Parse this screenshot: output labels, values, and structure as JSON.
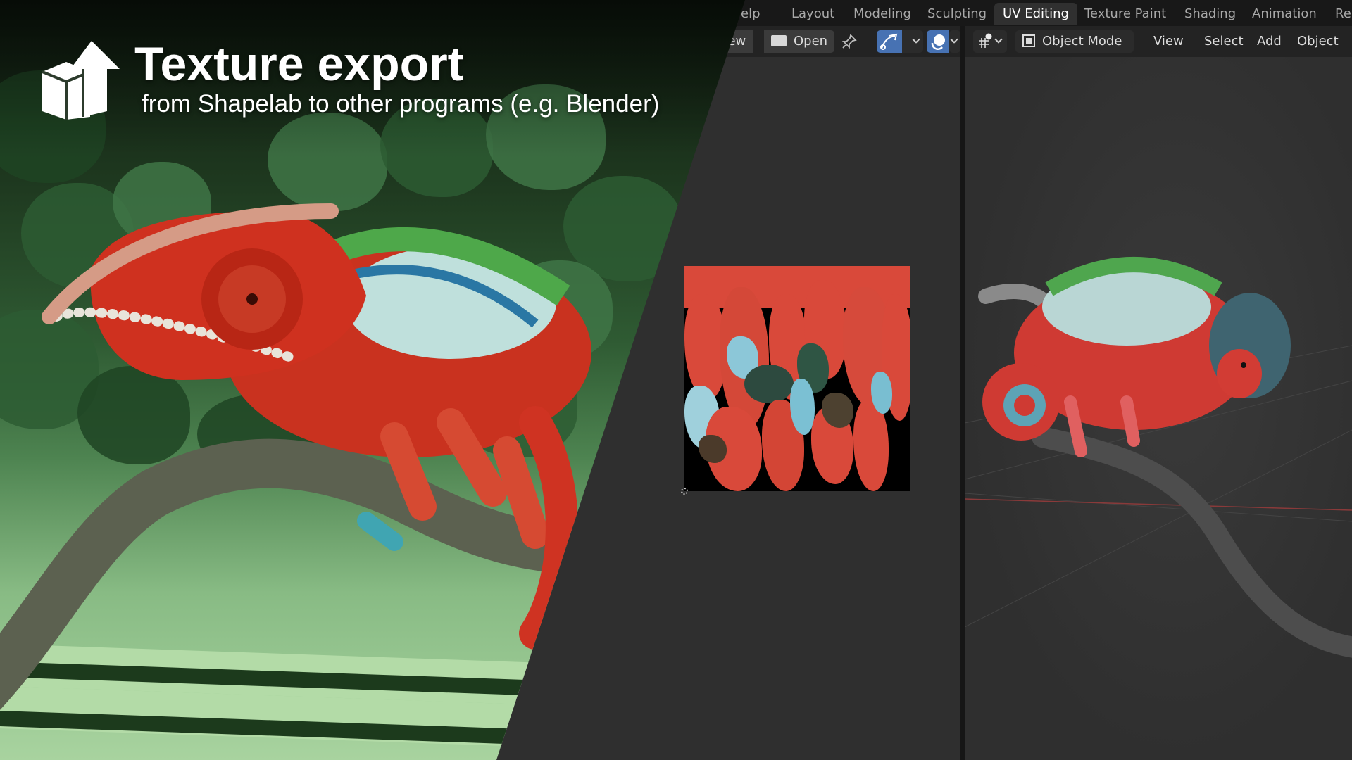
{
  "overlay": {
    "title": "Texture export",
    "subtitle": "from Shapelab to other programs (e.g. Blender)",
    "logo_icon": "box-upload-icon"
  },
  "blender": {
    "workspace_tabs": [
      {
        "label": "elp",
        "active": false
      },
      {
        "label": "Layout",
        "active": false
      },
      {
        "label": "Modeling",
        "active": false
      },
      {
        "label": "Sculpting",
        "active": false
      },
      {
        "label": "UV Editing",
        "active": true
      },
      {
        "label": "Texture Paint",
        "active": false
      },
      {
        "label": "Shading",
        "active": false
      },
      {
        "label": "Animation",
        "active": false
      },
      {
        "label": "Re",
        "active": false
      }
    ],
    "uv_editor_header": {
      "new_label": "New",
      "open_label": "Open",
      "pin_icon": "pin-icon",
      "uv_sync_icon": "uv-sync-icon",
      "overlay_icon": "overlay-icon"
    },
    "viewport_header": {
      "transform_icon": "transform-pivot-icon",
      "mode_label": "Object Mode",
      "menus": [
        "View",
        "Select",
        "Add",
        "Object"
      ],
      "selection_modes": [
        "select-new",
        "select-extend",
        "select-subtract",
        "select-difference",
        "select-intersect"
      ]
    },
    "colors": {
      "accent": "#4772b3",
      "panel_bg": "#303030",
      "header_bg": "#232323",
      "topbar_bg": "#181818",
      "texture_red": "#d9493a"
    }
  }
}
